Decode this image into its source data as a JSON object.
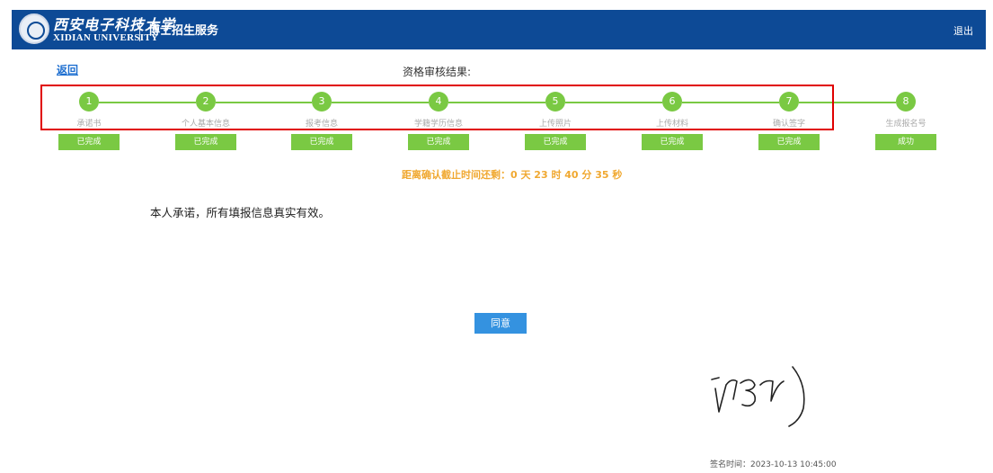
{
  "header": {
    "university_cn": "西安电子科技大学",
    "university_en": "XIDIAN UNIVERSITY",
    "system_title": "博士招生服务",
    "logout_label": "退出"
  },
  "nav": {
    "back_label": "返回"
  },
  "result_title": "资格审核结果:",
  "steps": [
    {
      "number": "1",
      "label": "承诺书",
      "status": "已完成"
    },
    {
      "number": "2",
      "label": "个人基本信息",
      "status": "已完成"
    },
    {
      "number": "3",
      "label": "报考信息",
      "status": "已完成"
    },
    {
      "number": "4",
      "label": "学籍学历信息",
      "status": "已完成"
    },
    {
      "number": "5",
      "label": "上传照片",
      "status": "已完成"
    },
    {
      "number": "6",
      "label": "上传材料",
      "status": "已完成"
    },
    {
      "number": "7",
      "label": "确认签字",
      "status": "已完成"
    },
    {
      "number": "8",
      "label": "生成报名号",
      "status": "成功"
    }
  ],
  "deadline_text": "距离确认截止时间还剩：0 天 23 时 40 分 35 秒",
  "pledge_text": "本人承诺，所有填报信息真实有效。",
  "agree_label": "同意",
  "sign_time_text": "签名时间：2023-10-13 10:45:00",
  "colors": {
    "header_bg": "#0d4a96",
    "step_green": "#7ac943",
    "deadline_orange": "#f0a830",
    "button_blue": "#3492e0",
    "highlight_red": "#e00000"
  }
}
